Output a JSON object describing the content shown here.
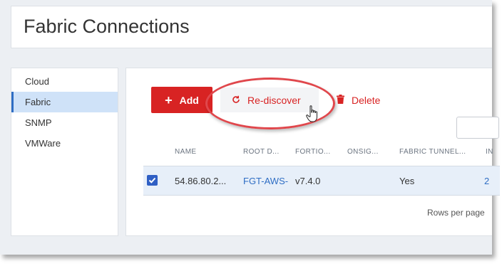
{
  "header": {
    "title": "Fabric Connections"
  },
  "sidebar": {
    "items": [
      {
        "label": "Cloud",
        "active": false
      },
      {
        "label": "Fabric",
        "active": true
      },
      {
        "label": "SNMP",
        "active": false
      },
      {
        "label": "VMWare",
        "active": false
      }
    ]
  },
  "toolbar": {
    "add_label": "Add",
    "add_icon": "plus-icon",
    "rediscover_label": "Re-discover",
    "rediscover_icon": "refresh-icon",
    "delete_label": "Delete",
    "delete_icon": "trash-icon"
  },
  "table": {
    "columns": [
      "NAME",
      "ROOT D...",
      "FORTIO...",
      "ONSIG...",
      "FABRIC TUNNEL...",
      "IN"
    ],
    "rows": [
      {
        "selected": true,
        "cells": [
          "54.86.80.2...",
          "FGT-AWS-",
          "v7.4.0",
          "",
          "Yes",
          "2"
        ]
      }
    ]
  },
  "footer": {
    "rows_per_page_label": "Rows per page"
  },
  "colors": {
    "accent_red": "#d82323",
    "link_blue": "#2f6ec4",
    "selected_row": "#e7eff9",
    "highlight_ring": "#e0474c"
  }
}
